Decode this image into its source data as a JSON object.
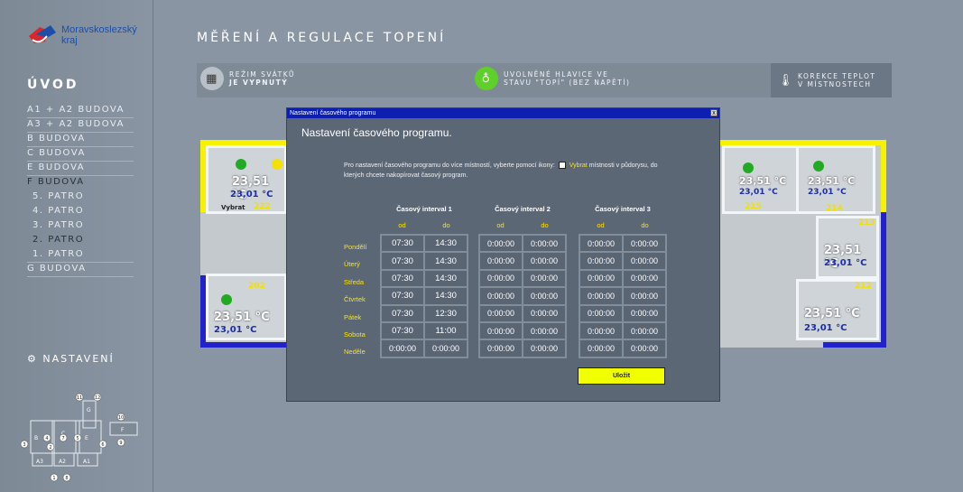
{
  "logo": {
    "line1": "Moravskoslezský",
    "line2": "kraj"
  },
  "sidebar": {
    "uvod": "ÚVOD",
    "items": [
      {
        "label": "A1 + A2 BUDOVA"
      },
      {
        "label": "A3 + A2 BUDOVA"
      },
      {
        "label": "B BUDOVA"
      },
      {
        "label": "C BUDOVA"
      },
      {
        "label": "E BUDOVA"
      },
      {
        "label": "F BUDOVA"
      },
      {
        "label": "5. PATRO"
      },
      {
        "label": "4. PATRO"
      },
      {
        "label": "3. PATRO"
      },
      {
        "label": "2. PATRO"
      },
      {
        "label": "1. PATRO"
      },
      {
        "label": "G BUDOVA"
      }
    ],
    "nastaveni": "NASTAVENÍ"
  },
  "header": {
    "title": "MĚŘENÍ A REGULACE TOPENÍ",
    "holiday_line1": "REŽIM SVÁTKŮ",
    "holiday_line2": "JE VYPNUTÝ",
    "valves_line1": "UVOLNĚNÉ HLAVICE VE",
    "valves_line2": "STAVU \"TOPÍ\" (BEZ NAPĚTÍ)",
    "correction_line1": "KOREKCE TEPLOT",
    "correction_line2": "V MÍSTNOSTECH"
  },
  "rooms": [
    {
      "number": "222",
      "temp": "23,51 °C",
      "set": "23,01 °C",
      "select": "Vybrat"
    },
    {
      "number": "202",
      "temp": "23,51 °C",
      "set": "23,01 °C",
      "select": "Vybrat"
    },
    {
      "number": "215",
      "temp": "23,51 °C",
      "set": "23,01 °C",
      "select": "Vybrat"
    },
    {
      "number": "214",
      "temp": "23,51 °C",
      "set": "23,01 °C",
      "select": "Vybrat"
    },
    {
      "number": "213",
      "temp": "23,51 °C",
      "set": "23,01 °C",
      "select": "Vybrat"
    },
    {
      "number": "212",
      "temp": "23,51 °C",
      "set": "23,01 °C",
      "select": "Vybrat"
    }
  ],
  "dialog": {
    "window_title": "Nastavení časového programu",
    "close": "x",
    "heading": "Nastavení časového programu.",
    "info_part1": "Pro nastavení časového programu do více místností, vyberte pomocí ikony:",
    "info_vybrat": "Vybrat",
    "info_part2": "místnosti v půdorysu, do kterých chcete nakopírovat časový program.",
    "od": "od",
    "do": "do",
    "intervals": [
      "Časový interval 1",
      "Časový interval 2",
      "Časový interval 3"
    ],
    "days": [
      "Pondělí",
      "Úterý",
      "Středa",
      "Čtvrtek",
      "Pátek",
      "Sobota",
      "Neděle"
    ],
    "values": [
      [
        [
          "07:30",
          "14:30"
        ],
        [
          "0:00:00",
          "0:00:00"
        ],
        [
          "0:00:00",
          "0:00:00"
        ]
      ],
      [
        [
          "07:30",
          "14:30"
        ],
        [
          "0:00:00",
          "0:00:00"
        ],
        [
          "0:00:00",
          "0:00:00"
        ]
      ],
      [
        [
          "07:30",
          "14:30"
        ],
        [
          "0:00:00",
          "0:00:00"
        ],
        [
          "0:00:00",
          "0:00:00"
        ]
      ],
      [
        [
          "07:30",
          "14:30"
        ],
        [
          "0:00:00",
          "0:00:00"
        ],
        [
          "0:00:00",
          "0:00:00"
        ]
      ],
      [
        [
          "07:30",
          "12:30"
        ],
        [
          "0:00:00",
          "0:00:00"
        ],
        [
          "0:00:00",
          "0:00:00"
        ]
      ],
      [
        [
          "07:30",
          "11:00"
        ],
        [
          "0:00:00",
          "0:00:00"
        ],
        [
          "0:00:00",
          "0:00:00"
        ]
      ],
      [
        [
          "0:00:00",
          "0:00:00"
        ],
        [
          "0:00:00",
          "0:00:00"
        ],
        [
          "0:00:00",
          "0:00:00"
        ]
      ]
    ],
    "save": "Uložit"
  },
  "minimap": {
    "labels": [
      "A3",
      "A2",
      "A1",
      "B",
      "C",
      "E",
      "F",
      "G"
    ],
    "numbers": [
      "1",
      "2",
      "3",
      "4",
      "5",
      "6",
      "7",
      "8",
      "9",
      "10",
      "11",
      "12"
    ]
  },
  "colors": {
    "accent_yellow": "#f2ff00",
    "titlebar_blue": "#0c1fb0",
    "day_label": "#ffe400"
  }
}
